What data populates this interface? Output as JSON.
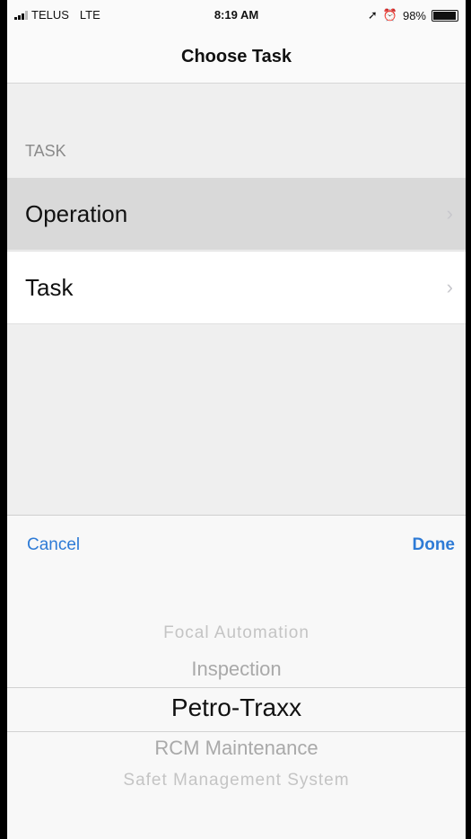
{
  "status_bar": {
    "carrier": "TELUS",
    "network": "LTE",
    "time": "8:19 AM",
    "battery": "98%"
  },
  "nav": {
    "title": "Choose Task"
  },
  "section": {
    "header": "TASK"
  },
  "rows": [
    {
      "label": "Operation",
      "chevron": "›"
    },
    {
      "label": "Task",
      "chevron": "›"
    }
  ],
  "picker": {
    "cancel_label": "Cancel",
    "done_label": "Done",
    "options": [
      "Focal Automation",
      "Inspection",
      "Petro-Traxx",
      "RCM Maintenance",
      "Safet Management System"
    ],
    "selected": "Petro-Traxx"
  },
  "colors": {
    "accent": "#2e7bd6",
    "selected_row": "#d9d9d9",
    "background": "#efefef"
  }
}
